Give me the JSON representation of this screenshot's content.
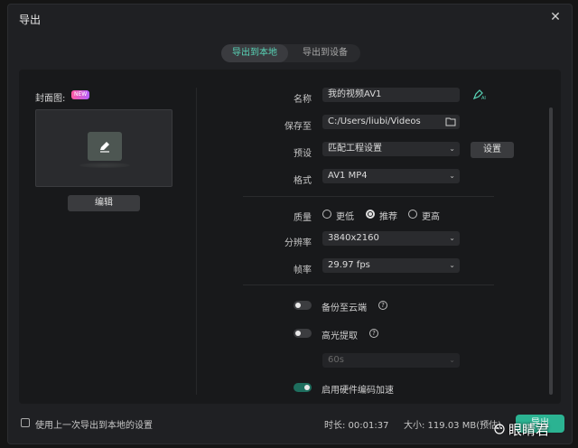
{
  "window": {
    "title": "导出"
  },
  "tabs": [
    {
      "label": "导出到本地"
    },
    {
      "label": "导出到设备"
    }
  ],
  "cover": {
    "label": "封面图:",
    "badge": "NEW",
    "edit_label": "编辑"
  },
  "form": {
    "name_label": "名称",
    "name_value": "我的视频AV1",
    "save_label": "保存至",
    "save_value": "C:/Users/liubi/Videos",
    "preset_label": "预设",
    "preset_value": "匹配工程设置",
    "preset_btn": "设置",
    "format_label": "格式",
    "format_value": "AV1 MP4",
    "quality_label": "质量",
    "quality_options": [
      "更低",
      "推荐",
      "更高"
    ],
    "quality_selected": "推荐",
    "resolution_label": "分辨率",
    "resolution_value": "3840x2160",
    "fps_label": "帧率",
    "fps_value": "29.97 fps",
    "backup_label": "备份至云端",
    "highlight_label": "高光提取",
    "highlight_value": "60s",
    "hw_label": "启用硬件编码加速"
  },
  "footer": {
    "use_last_label": "使用上一次导出到本地的设置",
    "duration": "时长: 00:01:37",
    "size": "大小: 119.03 MB(预估)",
    "export_label": "导出"
  },
  "watermark": "眼睛君",
  "colors": {
    "accent": "#59d6b8",
    "primary": "#2bb392"
  }
}
